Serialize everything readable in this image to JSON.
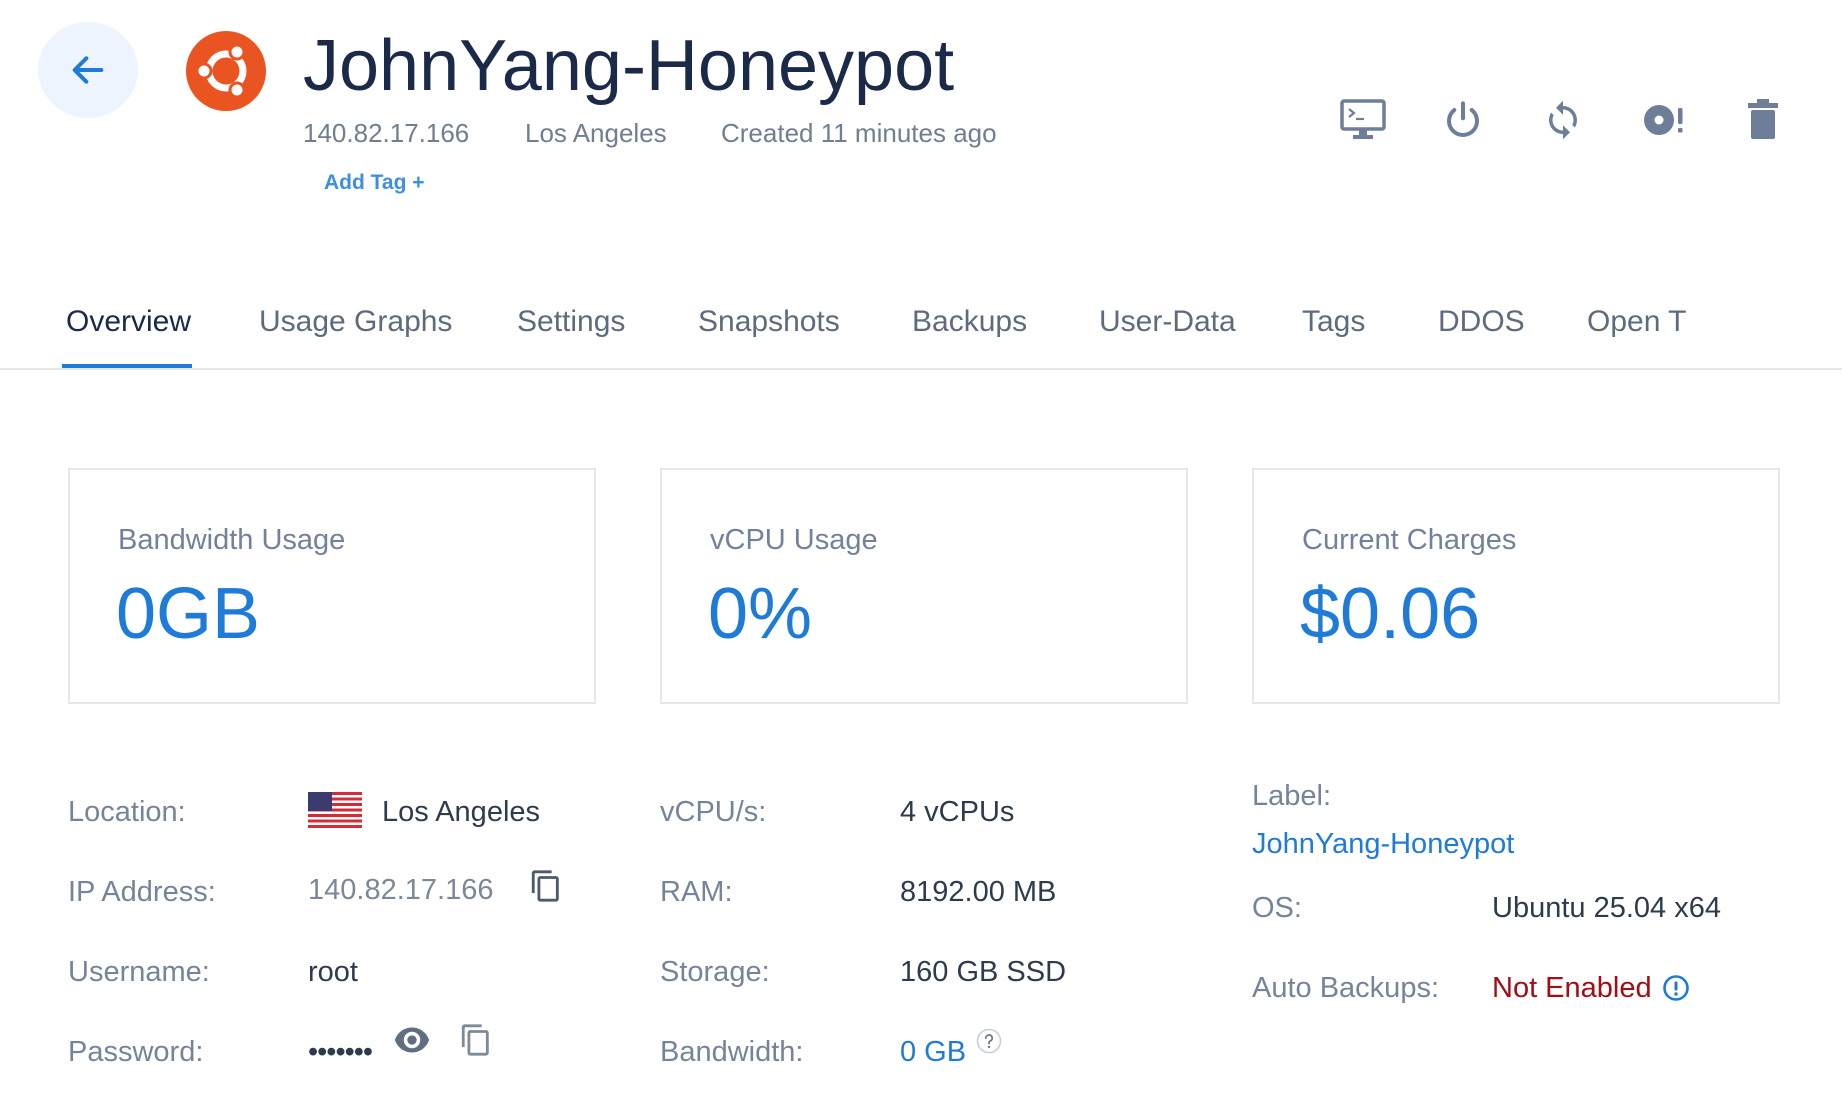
{
  "server": {
    "title": "JohnYang-Honeypot",
    "ip": "140.82.17.166",
    "location": "Los Angeles",
    "created": "Created 11 minutes ago",
    "add_tag_label": "Add Tag +"
  },
  "header_actions": [
    "console-icon",
    "power-icon",
    "restart-icon",
    "reinstall-icon",
    "trash-icon"
  ],
  "tabs": [
    {
      "label": "Overview",
      "active": true
    },
    {
      "label": "Usage Graphs"
    },
    {
      "label": "Settings"
    },
    {
      "label": "Snapshots"
    },
    {
      "label": "Backups"
    },
    {
      "label": "User-Data"
    },
    {
      "label": "Tags"
    },
    {
      "label": "DDOS"
    },
    {
      "label": "Open T"
    }
  ],
  "cards": [
    {
      "label": "Bandwidth Usage",
      "value": "0GB"
    },
    {
      "label": "vCPU Usage",
      "value": "0%"
    },
    {
      "label": "Current Charges",
      "value": "$0.06"
    }
  ],
  "details": {
    "location_label": "Location:",
    "location_value": "Los Angeles",
    "ip_label": "IP Address:",
    "ip_value": "140.82.17.166",
    "username_label": "Username:",
    "username_value": "root",
    "password_label": "Password:",
    "password_value": "•••••••",
    "vcpu_label": "vCPU/s:",
    "vcpu_value": "4 vCPUs",
    "ram_label": "RAM:",
    "ram_value": "8192.00 MB",
    "storage_label": "Storage:",
    "storage_value": "160 GB SSD",
    "bandwidth_label": "Bandwidth:",
    "bandwidth_value": "0 GB",
    "server_label_label": "Label:",
    "server_label_value": "JohnYang-Honeypot",
    "os_label": "OS:",
    "os_value": "Ubuntu 25.04 x64",
    "backups_label": "Auto Backups:",
    "backups_value": "Not Enabled"
  },
  "colors": {
    "accent": "#1e7bd8",
    "ubuntu_orange": "#e95420",
    "danger": "#a20d16",
    "icon_gray": "#6e7e98"
  }
}
